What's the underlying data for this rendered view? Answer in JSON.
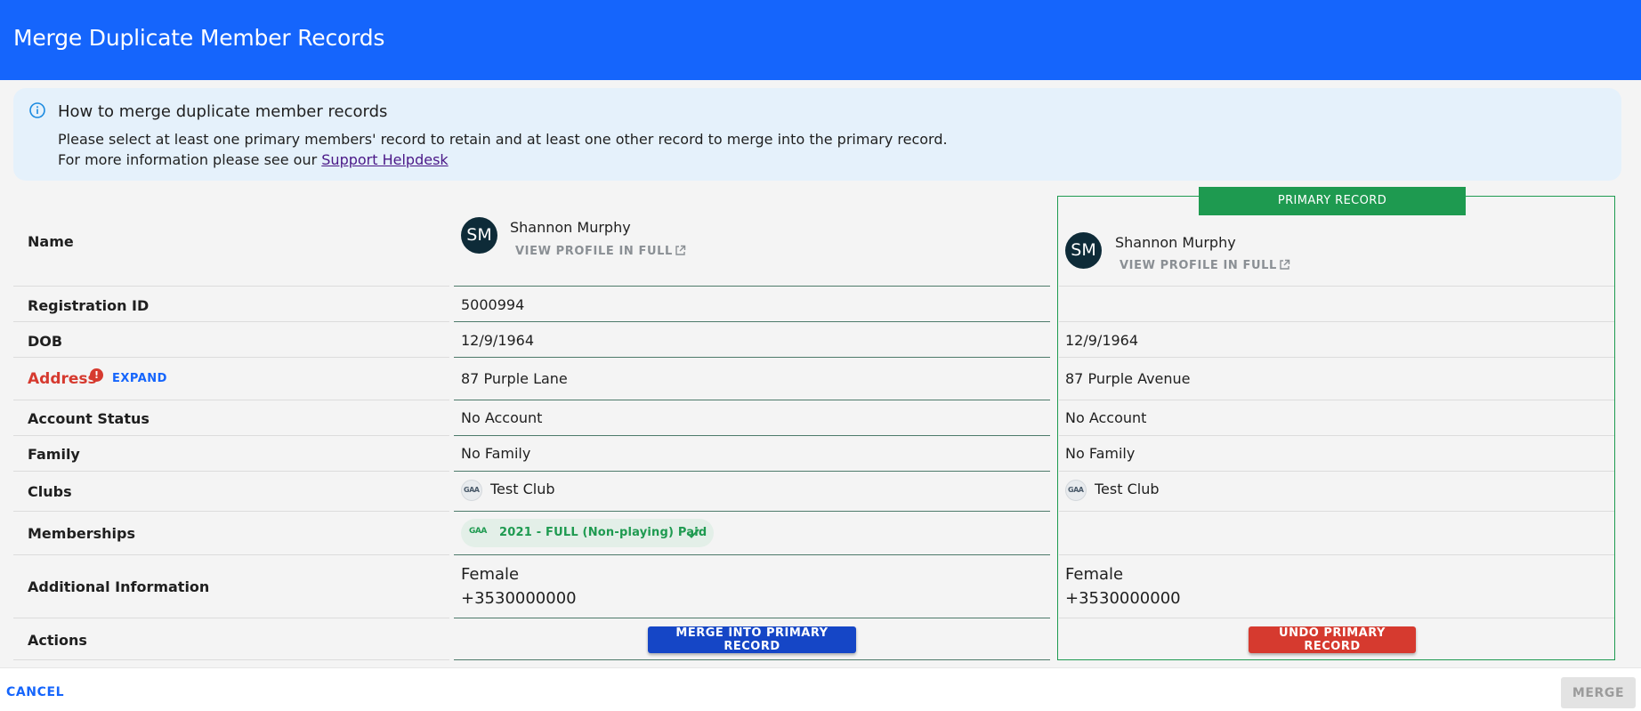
{
  "dialog": {
    "title": "Merge Duplicate Member Records"
  },
  "info": {
    "icon": "info-icon",
    "title": "How to merge duplicate member records",
    "text": "Please select at least one primary members' record to retain and at least one other record to merge into the primary record.",
    "text2_prefix": "For more information please see our ",
    "link_label": "Support Helpdesk"
  },
  "primary_tag": "PRIMARY RECORD",
  "labels": {
    "name": "Name",
    "registration_id": "Registration ID",
    "dob": "DOB",
    "address": "Address",
    "address_error_icon": "error-icon",
    "expand": "EXPAND",
    "account_status": "Account Status",
    "family": "Family",
    "clubs": "Clubs",
    "memberships": "Memberships",
    "additional_information": "Additional Information",
    "actions": "Actions"
  },
  "records": [
    {
      "initials": "SM",
      "name": "Shannon Murphy",
      "view_profile": "VIEW PROFILE IN FULL",
      "registration_id": "5000994",
      "dob": "12/9/1964",
      "address": "87 Purple Lane",
      "account_status": "No Account",
      "family": "No Family",
      "club_logo": "GAA",
      "club": "Test Club",
      "membership": "2021 - FULL (Non-playing) Paid",
      "membership_logo": "GAA",
      "gender": "Female",
      "phone": "+3530000000",
      "action_label": "MERGE INTO PRIMARY RECORD"
    },
    {
      "initials": "SM",
      "name": "Shannon Murphy",
      "view_profile": "VIEW PROFILE IN FULL",
      "registration_id": "",
      "dob": "12/9/1964",
      "address": "87 Purple Avenue",
      "account_status": "No Account",
      "family": "No Family",
      "club_logo": "GAA",
      "club": "Test Club",
      "membership": "",
      "gender": "Female",
      "phone": "+3530000000",
      "action_label": "UNDO PRIMARY RECORD"
    }
  ],
  "footer": {
    "cancel_label": "CANCEL",
    "merge_label": "MERGE"
  },
  "colors": {
    "header": "#1565fc",
    "primary_green": "#1e9a50",
    "error_red": "#d63a2f",
    "merge_button": "#1546c6"
  }
}
